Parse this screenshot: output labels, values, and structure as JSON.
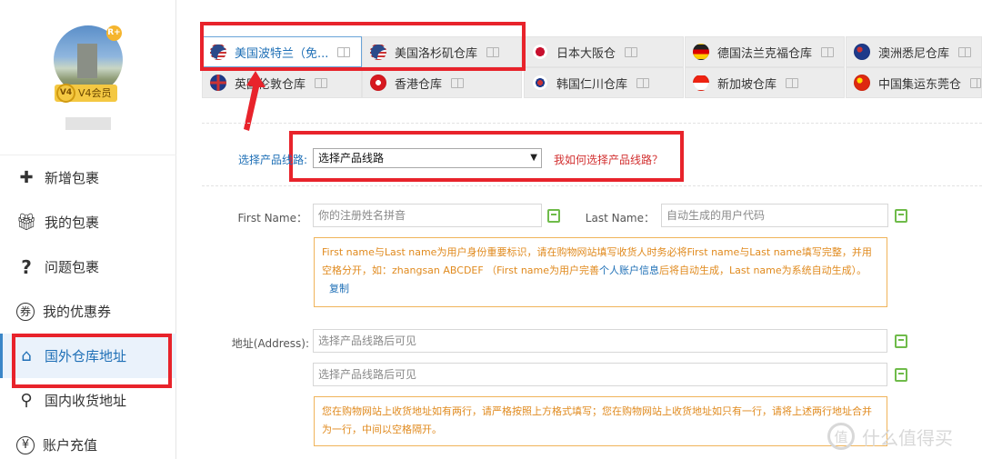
{
  "sidebar": {
    "badge_r": "R+",
    "vip_level": "V4",
    "vip_label": "V4会员",
    "items": [
      {
        "label": "新增包裹",
        "icon": "plus-icon"
      },
      {
        "label": "我的包裹",
        "icon": "gift-icon"
      },
      {
        "label": "问题包裹",
        "icon": "question-icon"
      },
      {
        "label": "我的优惠券",
        "icon": "coupon-icon"
      },
      {
        "label": "国外仓库地址",
        "icon": "home-icon",
        "active": true
      },
      {
        "label": "国内收货地址",
        "icon": "location-pin-icon"
      },
      {
        "label": "账户充值",
        "icon": "yen-icon"
      }
    ]
  },
  "tabs": [
    {
      "label": "美国波特兰（免...",
      "flag": "us",
      "active": true
    },
    {
      "label": "美国洛杉矶仓库",
      "flag": "us"
    },
    {
      "label": "日本大阪仓",
      "flag": "jp"
    },
    {
      "label": "德国法兰克福仓库",
      "flag": "de"
    },
    {
      "label": "澳洲悉尼仓库",
      "flag": "au"
    },
    {
      "label": "英国伦敦仓库",
      "flag": "uk"
    },
    {
      "label": "香港仓库",
      "flag": "hk"
    },
    {
      "label": "韩国仁川仓库",
      "flag": "kr"
    },
    {
      "label": "新加坡仓库",
      "flag": "sg"
    },
    {
      "label": "中国集运东莞仓",
      "flag": "cn"
    }
  ],
  "form": {
    "line_label": "选择产品线路:",
    "line_select": "选择产品线路",
    "line_help": "我如何选择产品线路？",
    "first_name_label": "First Name：",
    "first_name_placeholder": "你的注册姓名拼音",
    "last_name_label": "Last Name：",
    "last_name_placeholder": "自动生成的用户代码",
    "name_note_1": "First name与Last name为用户身份重要标识，请在购物网站填写收货人时务必将First name与Last name填写完整，并用空格分开，如：zhangsan ABCDEF （First name为用户完善",
    "name_note_link_text": "个人账户信息",
    "name_note_2": "后将自动生成，Last name为系统自动生成）。",
    "name_note_copy": "复制",
    "address_label": "地址(Address):",
    "address_placeholder_1": "选择产品线路后可见",
    "address_placeholder_2": "选择产品线路后可见",
    "address_note": "您在购物网站上收货地址如有两行，请严格按照上方格式填写；您在购物网站上收货地址如只有一行，请将上述两行地址合并为一行，中间以空格隔开。"
  },
  "watermark": {
    "glyph": "值",
    "text": "什么值得买"
  }
}
